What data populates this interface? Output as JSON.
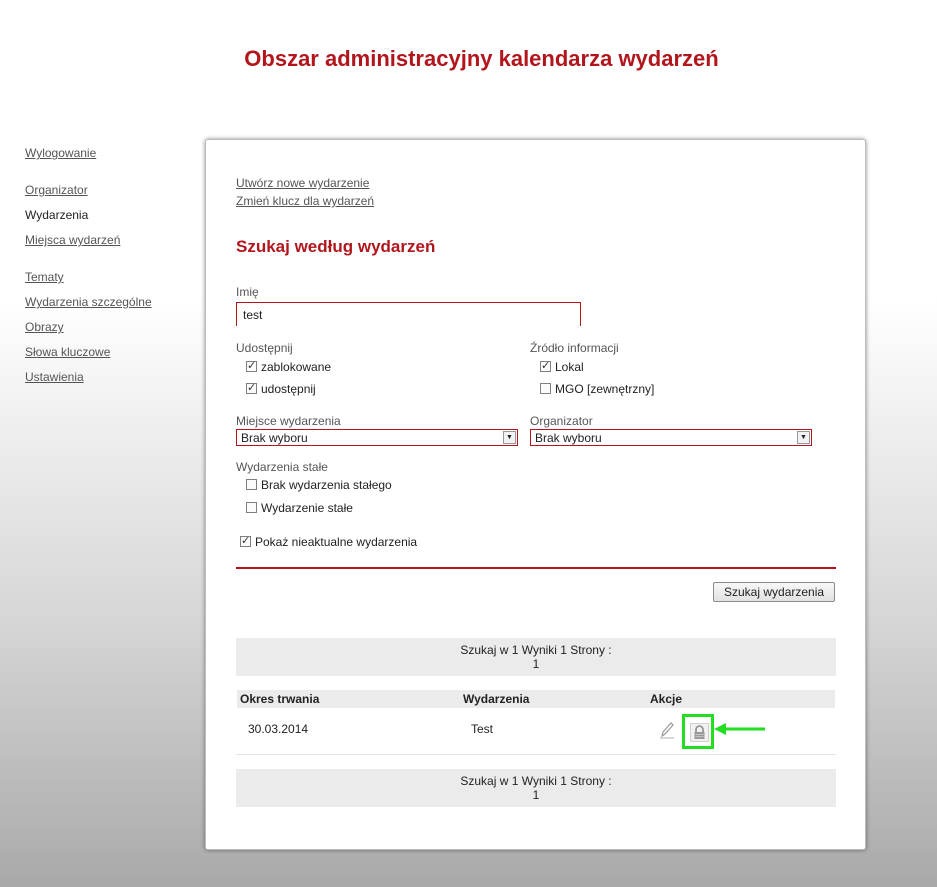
{
  "page": {
    "title": "Obszar administracyjny kalendarza wydarzeń"
  },
  "sidebar": {
    "items": [
      {
        "label": "Wylogowanie",
        "current": false
      },
      {
        "label": "Organizator",
        "current": false
      },
      {
        "label": "Wydarzenia",
        "current": true
      },
      {
        "label": "Miejsca wydarzeń",
        "current": false
      },
      {
        "label": "Tematy",
        "current": false
      },
      {
        "label": "Wydarzenia szczególne",
        "current": false
      },
      {
        "label": "Obrazy",
        "current": false
      },
      {
        "label": "Słowa kluczowe",
        "current": false
      },
      {
        "label": "Ustawienia",
        "current": false
      }
    ]
  },
  "actions": {
    "create_event": "Utwórz nowe wydarzenie",
    "change_key": "Zmień klucz dla wydarzeń"
  },
  "search": {
    "title": "Szukaj według wydarzeń",
    "name_label": "Imię",
    "name_value": "test",
    "share_label": "Udostępnij",
    "share_blocked": {
      "label": "zablokowane",
      "checked": true
    },
    "share_enable": {
      "label": "udostępnij",
      "checked": true
    },
    "source_label": "Źródło informacji",
    "source_local": {
      "label": "Lokal",
      "checked": true
    },
    "source_mgo": {
      "label": "MGO [zewnętrzny]",
      "checked": false
    },
    "venue_label": "Miejsce wydarzenia",
    "venue_value": "Brak wyboru",
    "organizer_label": "Organizator",
    "organizer_value": "Brak wyboru",
    "permanent_label": "Wydarzenia stałe",
    "permanent_none": {
      "label": "Brak wydarzenia stałego",
      "checked": false
    },
    "permanent_yes": {
      "label": "Wydarzenie stałe",
      "checked": false
    },
    "show_outdated": {
      "label": "Pokaż nieaktualne wydarzenia",
      "checked": true
    },
    "submit_label": "Szukaj wydarzenia"
  },
  "results": {
    "pager_line1": "Szukaj w 1 Wyniki 1 Strony :",
    "pager_line2": "1",
    "columns": [
      "Okres trwania",
      "Wydarzenia",
      "Akcje"
    ],
    "rows": [
      {
        "period": "30.03.2014",
        "event": "Test"
      }
    ],
    "icons": {
      "edit": "pencil-icon",
      "lock": "lock-icon",
      "annotation": "green-arrow"
    },
    "colors": {
      "highlight": "#22dd22",
      "accent": "#b2161c"
    }
  }
}
